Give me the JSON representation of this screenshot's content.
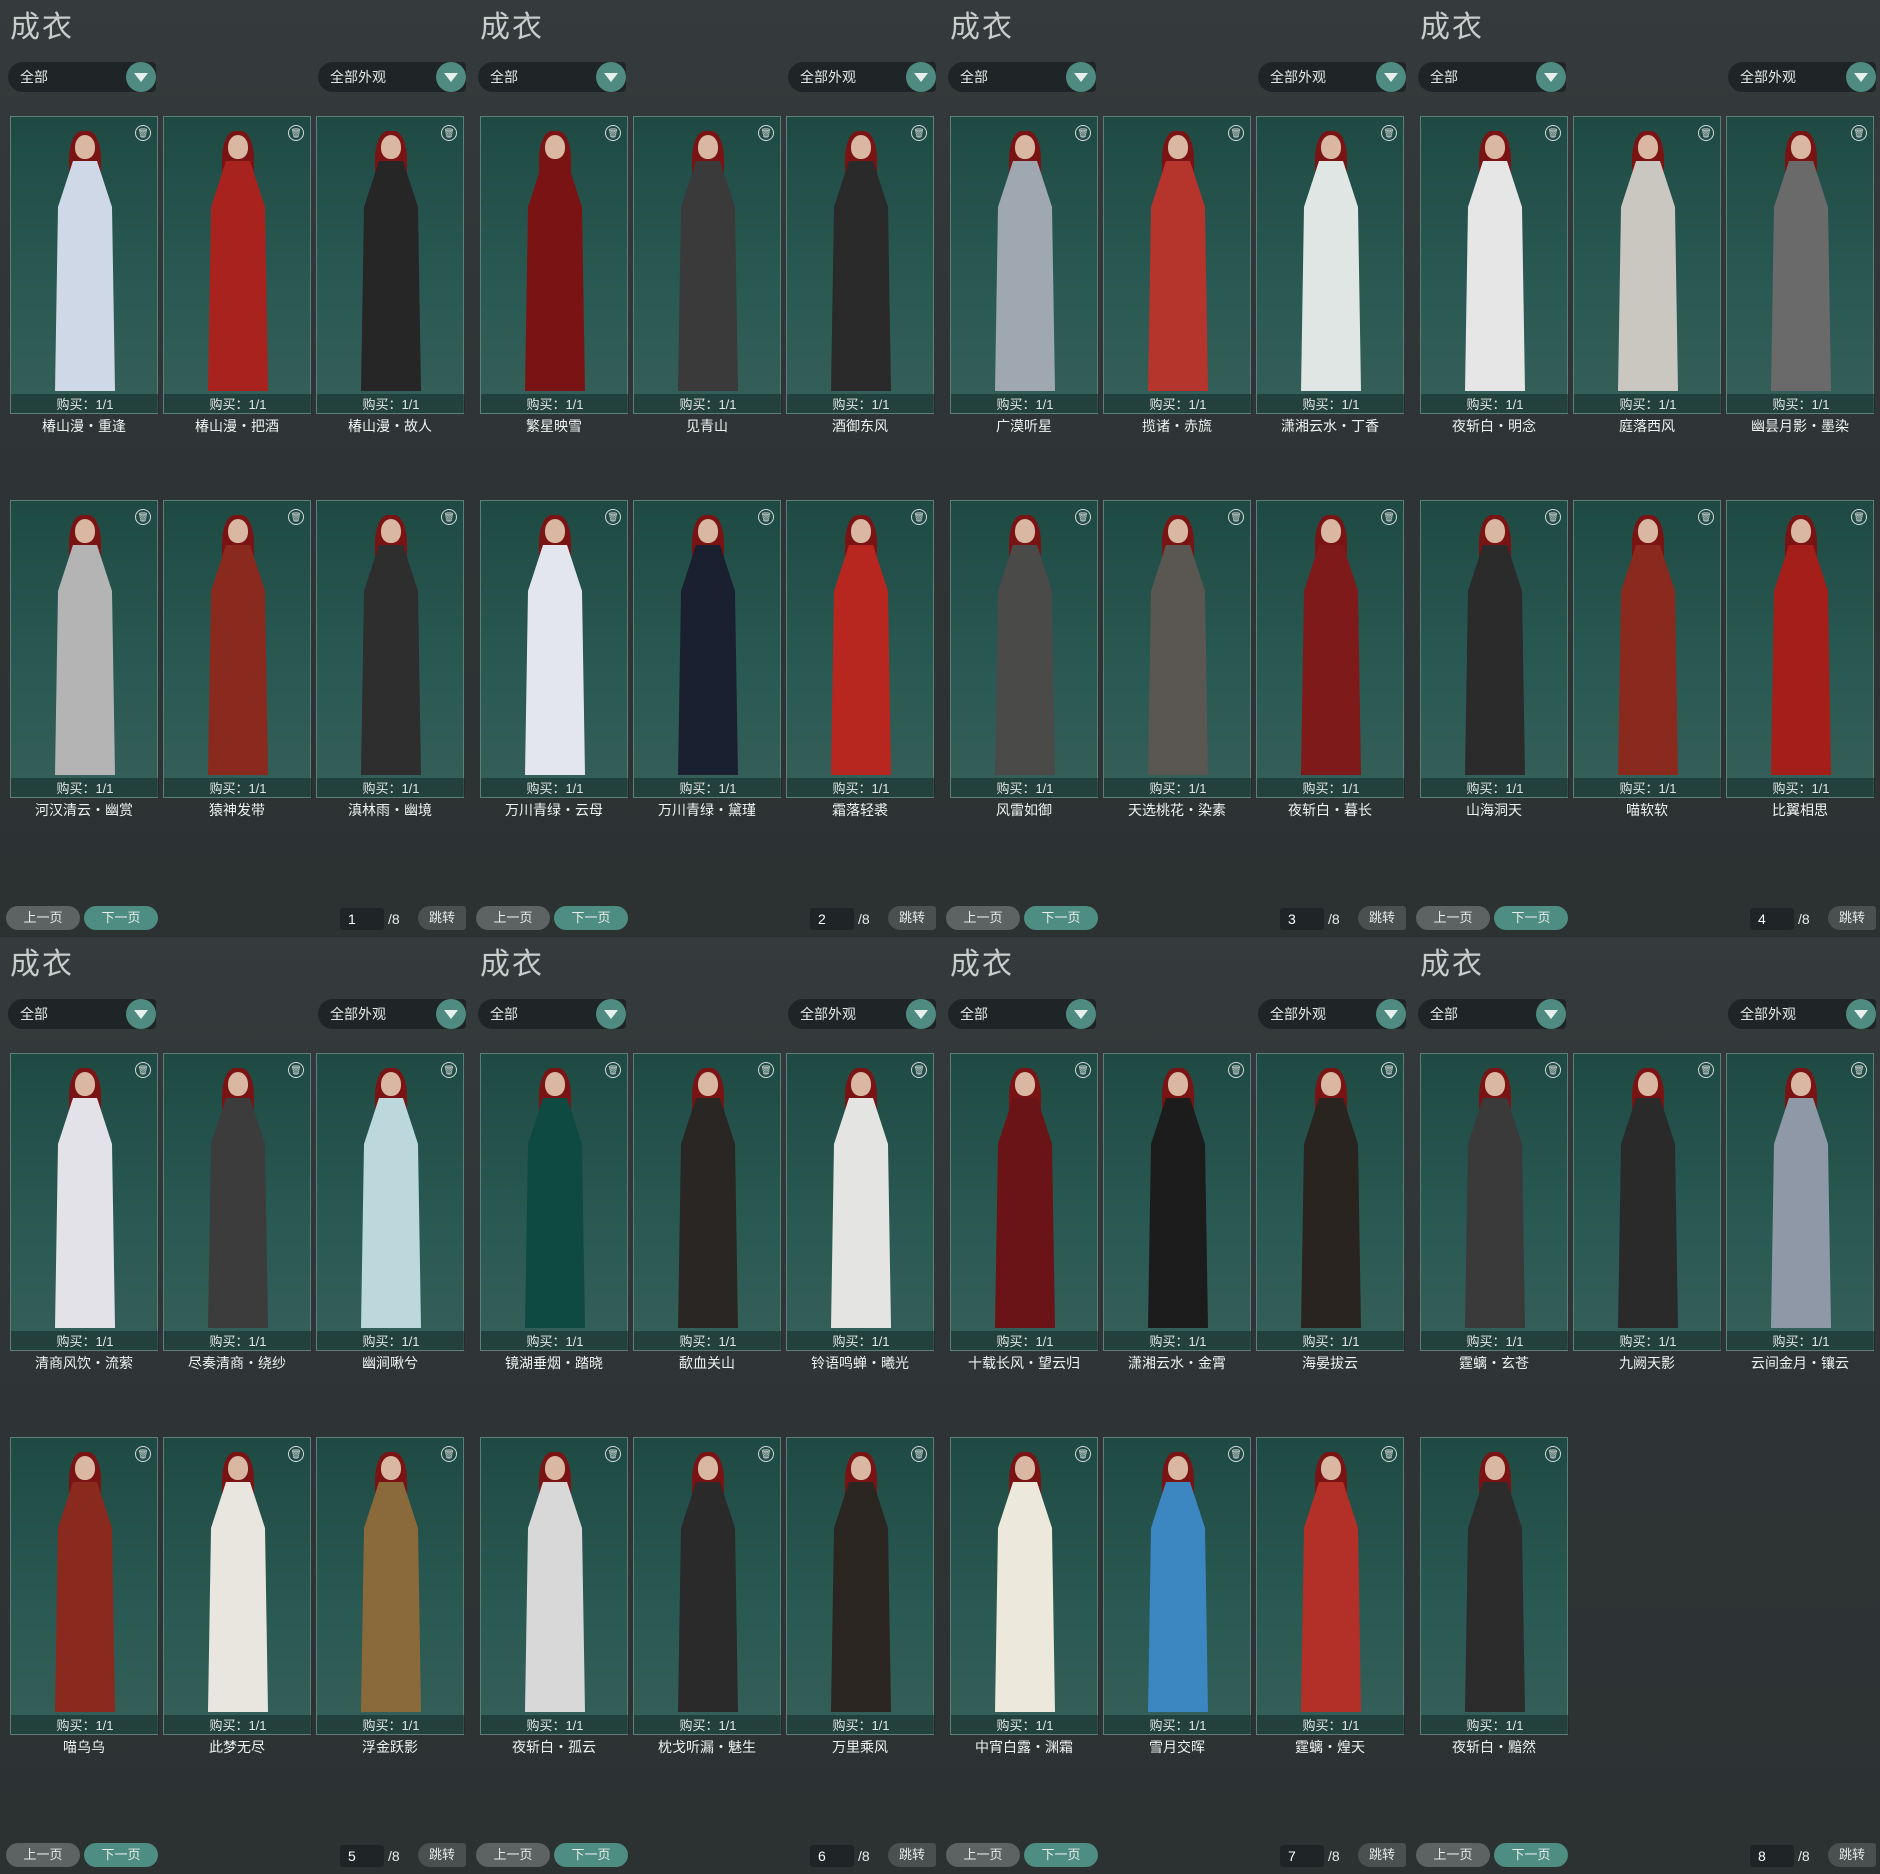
{
  "panels": [
    {
      "title": "成衣",
      "filter_left": "全部",
      "filter_right": "全部外观",
      "prev": "上一页",
      "next": "下一页",
      "page": "1",
      "total": "/8",
      "jump": "跳转",
      "items": [
        {
          "name": "椿山漫・重逢",
          "buy": "购买：1/1",
          "robe": "#cfd8e6"
        },
        {
          "name": "椿山漫・把酒",
          "buy": "购买：1/1",
          "robe": "#a8231e"
        },
        {
          "name": "椿山漫・故人",
          "buy": "购买：1/1",
          "robe": "#262626"
        },
        {
          "name": "河汉清云・幽赏",
          "buy": "购买：1/1",
          "robe": "#b4b4b4"
        },
        {
          "name": "猿神发带",
          "buy": "购买：1/1",
          "robe": "#8a2a1f"
        },
        {
          "name": "滇林雨・幽境",
          "buy": "购买：1/1",
          "robe": "#2e2e2e"
        }
      ]
    },
    {
      "title": "成衣",
      "filter_left": "全部",
      "filter_right": "全部外观",
      "prev": "上一页",
      "next": "下一页",
      "page": "2",
      "total": "/8",
      "jump": "跳转",
      "items": [
        {
          "name": "繁星映雪",
          "buy": "购买：1/1",
          "robe": "#7a1414"
        },
        {
          "name": "见青山",
          "buy": "购买：1/1",
          "robe": "#3a3a3a"
        },
        {
          "name": "酒御东风",
          "buy": "购买：1/1",
          "robe": "#2a2a2a"
        },
        {
          "name": "万川青绿・云母",
          "buy": "购买：1/1",
          "robe": "#e4e6ee"
        },
        {
          "name": "万川青绿・黛瑾",
          "buy": "购买：1/1",
          "robe": "#1b2030"
        },
        {
          "name": "霜落轻裘",
          "buy": "购买：1/1",
          "robe": "#b7271f"
        }
      ]
    },
    {
      "title": "成衣",
      "filter_left": "全部",
      "filter_right": "全部外观",
      "prev": "上一页",
      "next": "下一页",
      "page": "3",
      "total": "/8",
      "jump": "跳转",
      "items": [
        {
          "name": "广漠听星",
          "buy": "购买：1/1",
          "robe": "#9fa7b0"
        },
        {
          "name": "揽诸・赤旒",
          "buy": "购买：1/1",
          "robe": "#b5342c"
        },
        {
          "name": "潇湘云水・丁香",
          "buy": "购买：1/1",
          "robe": "#dfe6e4"
        },
        {
          "name": "风雷如御",
          "buy": "购买：1/1",
          "robe": "#4a4a48"
        },
        {
          "name": "天选桃花・染素",
          "buy": "购买：1/1",
          "robe": "#5a5652"
        },
        {
          "name": "夜斩白・暮长",
          "buy": "购买：1/1",
          "robe": "#7e1a1a"
        }
      ]
    },
    {
      "title": "成衣",
      "filter_left": "全部",
      "filter_right": "全部外观",
      "prev": "上一页",
      "next": "下一页",
      "page": "4",
      "total": "/8",
      "jump": "跳转",
      "items": [
        {
          "name": "夜斩白・明念",
          "buy": "购买：1/1",
          "robe": "#e6e6e6"
        },
        {
          "name": "庭落西风",
          "buy": "购买：1/1",
          "robe": "#c9c7c0"
        },
        {
          "name": "幽昙月影・墨染",
          "buy": "购买：1/1",
          "robe": "#6a6a6a"
        },
        {
          "name": "山海洞天",
          "buy": "购买：1/1",
          "robe": "#2b2b2b"
        },
        {
          "name": "喵软软",
          "buy": "购买：1/1",
          "robe": "#8a2a1f"
        },
        {
          "name": "比翼相思",
          "buy": "购买：1/1",
          "robe": "#a51f1a"
        }
      ]
    },
    {
      "title": "成衣",
      "filter_left": "全部",
      "filter_right": "全部外观",
      "prev": "上一页",
      "next": "下一页",
      "page": "5",
      "total": "/8",
      "jump": "跳转",
      "items": [
        {
          "name": "清商风饮・流萦",
          "buy": "购买：1/1",
          "robe": "#e2e2e8"
        },
        {
          "name": "尽奏清商・绕纱",
          "buy": "购买：1/1",
          "robe": "#3c3c3c"
        },
        {
          "name": "幽涧啾兮",
          "buy": "购买：1/1",
          "robe": "#bcd8dc"
        },
        {
          "name": "喵乌乌",
          "buy": "购买：1/1",
          "robe": "#8a2a1f"
        },
        {
          "name": "此梦无尽",
          "buy": "购买：1/1",
          "robe": "#e8e6df"
        },
        {
          "name": "浮金跃影",
          "buy": "购买：1/1",
          "robe": "#8a6a3a"
        }
      ]
    },
    {
      "title": "成衣",
      "filter_left": "全部",
      "filter_right": "全部外观",
      "prev": "上一页",
      "next": "下一页",
      "page": "6",
      "total": "/8",
      "jump": "跳转",
      "items": [
        {
          "name": "镜湖垂烟・踏晓",
          "buy": "购买：1/1",
          "robe": "#0f4a42"
        },
        {
          "name": "歃血关山",
          "buy": "购买：1/1",
          "robe": "#2a2624"
        },
        {
          "name": "铃语鸣蝉・曦光",
          "buy": "购买：1/1",
          "robe": "#e4e4e2"
        },
        {
          "name": "夜斩白・孤云",
          "buy": "购买：1/1",
          "robe": "#d8d8d8"
        },
        {
          "name": "枕戈听漏・魅生",
          "buy": "购买：1/1",
          "robe": "#2a2a2a"
        },
        {
          "name": "万里乘风",
          "buy": "购买：1/1",
          "robe": "#2c2622"
        }
      ]
    },
    {
      "title": "成衣",
      "filter_left": "全部",
      "filter_right": "全部外观",
      "prev": "上一页",
      "next": "下一页",
      "page": "7",
      "total": "/8",
      "jump": "跳转",
      "items": [
        {
          "name": "十载长风・望云归",
          "buy": "购买：1/1",
          "robe": "#6a1418"
        },
        {
          "name": "潇湘云水・金霄",
          "buy": "购买：1/1",
          "robe": "#1c1c1c"
        },
        {
          "name": "海晏拔云",
          "buy": "购买：1/1",
          "robe": "#2a2420"
        },
        {
          "name": "中宵白露・渊霜",
          "buy": "购买：1/1",
          "robe": "#ece8dc"
        },
        {
          "name": "雪月交晖",
          "buy": "购买：1/1",
          "robe": "#3c86c2"
        },
        {
          "name": "霆螭・煌天",
          "buy": "购买：1/1",
          "robe": "#b33028"
        }
      ]
    },
    {
      "title": "成衣",
      "filter_left": "全部",
      "filter_right": "全部外观",
      "prev": "上一页",
      "next": "下一页",
      "page": "8",
      "total": "/8",
      "jump": "跳转",
      "items": [
        {
          "name": "霆螭・玄苍",
          "buy": "购买：1/1",
          "robe": "#3a3a3a"
        },
        {
          "name": "九阙天影",
          "buy": "购买：1/1",
          "robe": "#2a2a2a"
        },
        {
          "name": "云间金月・镶云",
          "buy": "购买：1/1",
          "robe": "#8f98a6"
        },
        {
          "name": "夜斩白・黯然",
          "buy": "购买：1/1",
          "robe": "#2c2c2c"
        }
      ]
    }
  ]
}
